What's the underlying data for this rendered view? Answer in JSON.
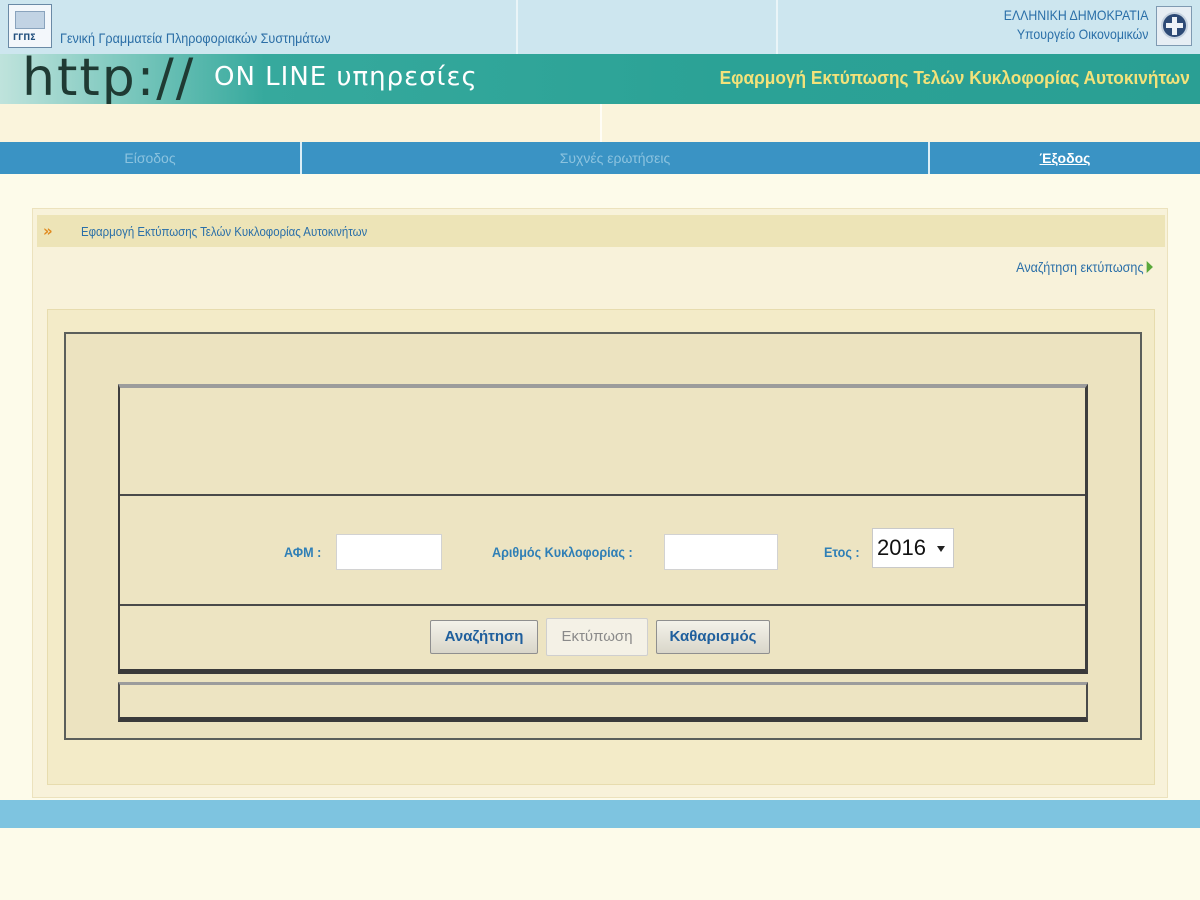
{
  "header": {
    "org_logo_text": "ΓΓΠΣ",
    "org_name": "Γενική Γραμματεία Πληροφοριακών Συστημάτων",
    "gov_line1": "ΕΛΛΗΝΙΚΗ ΔΗΜΟΚΡΑΤΙΑ",
    "gov_line2": "Υπουργείο Οικονομικών"
  },
  "banner": {
    "http_text": "http://",
    "online_text": "ON LINE υπηρεσίες",
    "app_title": "Εφαρμογή Εκτύπωσης Τελών Κυκλοφορίας Αυτοκινήτων"
  },
  "nav": {
    "login": "Είσοδος",
    "faq": "Συχνές ερωτήσεις",
    "exit": "Έξοδος"
  },
  "content": {
    "breadcrumb": "Εφαρμογή Εκτύπωσης Τελών Κυκλοφορίας Αυτοκινήτων",
    "search_print_link": "Αναζήτηση εκτύπωσης"
  },
  "form": {
    "afm_label": "ΑΦΜ :",
    "afm_value": "",
    "plate_label": "Αριθμός Κυκλοφορίας :",
    "plate_value": "",
    "year_label": "Ετος :",
    "year_value": "2016"
  },
  "buttons": {
    "search": "Αναζήτηση",
    "print": "Εκτύπωση",
    "clear": "Καθαρισμός"
  },
  "colors": {
    "nav_bg": "#3a93c4",
    "banner_accent": "#2ba296",
    "title_yellow": "#f3e27a",
    "link_blue": "#2a6fa8"
  }
}
